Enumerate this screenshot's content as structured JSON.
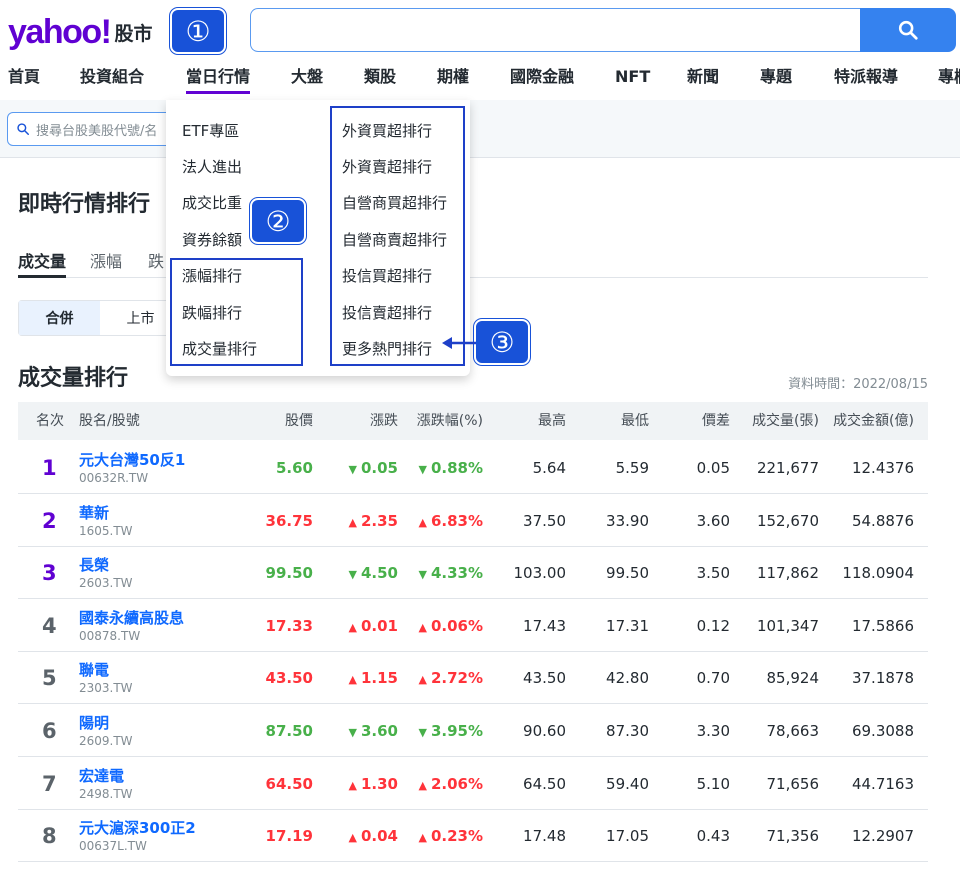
{
  "header": {
    "logo_text": "yahoo!",
    "logo_sub": "股市",
    "badges": [
      "①",
      "②",
      "③"
    ],
    "search_placeholder": "",
    "search_icon": "search-icon"
  },
  "nav": {
    "items": [
      "首頁",
      "投資組合",
      "當日行情",
      "大盤",
      "類股",
      "期權",
      "國際金融",
      "NFT",
      "新聞",
      "專題",
      "特派報導",
      "專欄"
    ],
    "active": "當日行情"
  },
  "quote_search_placeholder": "搜尋台股美股代號/名",
  "dropdown": {
    "left": [
      "ETF專區",
      "法人進出",
      "成交比重",
      "資券餘額",
      "漲幅排行",
      "跌幅排行",
      "成交量排行"
    ],
    "right": [
      "外資買超排行",
      "外資賣超排行",
      "自營商買超排行",
      "自營商賣超排行",
      "投信買超排行",
      "投信賣超排行",
      "更多熱門排行"
    ]
  },
  "page_title": "即時行情排行",
  "tabs": [
    "成交量",
    "漲幅",
    "跌"
  ],
  "segments": [
    "合併",
    "上市"
  ],
  "section_title": "成交量排行",
  "data_time": "資料時間：2022/08/15",
  "table": {
    "headers": [
      "名次",
      "股名/股號",
      "股價",
      "漲跌",
      "漲跌幅(%)",
      "最高",
      "最低",
      "價差",
      "成交量(張)",
      "成交金額(億)"
    ],
    "rows": [
      {
        "rank": "1",
        "name": "元大台灣50反1",
        "code": "00632R.TW",
        "price": "5.60",
        "dir": "down",
        "change": "0.05",
        "pct": "0.88%",
        "high": "5.64",
        "low": "5.59",
        "spread": "0.05",
        "volume": "221,677",
        "amount": "12.4376"
      },
      {
        "rank": "2",
        "name": "華新",
        "code": "1605.TW",
        "price": "36.75",
        "dir": "up",
        "change": "2.35",
        "pct": "6.83%",
        "high": "37.50",
        "low": "33.90",
        "spread": "3.60",
        "volume": "152,670",
        "amount": "54.8876"
      },
      {
        "rank": "3",
        "name": "長榮",
        "code": "2603.TW",
        "price": "99.50",
        "dir": "down",
        "change": "4.50",
        "pct": "4.33%",
        "high": "103.00",
        "low": "99.50",
        "spread": "3.50",
        "volume": "117,862",
        "amount": "118.0904"
      },
      {
        "rank": "4",
        "name": "國泰永續高股息",
        "code": "00878.TW",
        "price": "17.33",
        "dir": "up",
        "change": "0.01",
        "pct": "0.06%",
        "high": "17.43",
        "low": "17.31",
        "spread": "0.12",
        "volume": "101,347",
        "amount": "17.5866"
      },
      {
        "rank": "5",
        "name": "聯電",
        "code": "2303.TW",
        "price": "43.50",
        "dir": "up",
        "change": "1.15",
        "pct": "2.72%",
        "high": "43.50",
        "low": "42.80",
        "spread": "0.70",
        "volume": "85,924",
        "amount": "37.1878"
      },
      {
        "rank": "6",
        "name": "陽明",
        "code": "2609.TW",
        "price": "87.50",
        "dir": "down",
        "change": "3.60",
        "pct": "3.95%",
        "high": "90.60",
        "low": "87.30",
        "spread": "3.30",
        "volume": "78,663",
        "amount": "69.3088"
      },
      {
        "rank": "7",
        "name": "宏達電",
        "code": "2498.TW",
        "price": "64.50",
        "dir": "up",
        "change": "1.30",
        "pct": "2.06%",
        "high": "64.50",
        "low": "59.40",
        "spread": "5.10",
        "volume": "71,656",
        "amount": "44.7163"
      },
      {
        "rank": "8",
        "name": "元大滬深300正2",
        "code": "00637L.TW",
        "price": "17.19",
        "dir": "up",
        "change": "0.04",
        "pct": "0.23%",
        "high": "17.48",
        "low": "17.05",
        "spread": "0.43",
        "volume": "71,356",
        "amount": "12.2907"
      }
    ]
  },
  "colors": {
    "brand": "#6001d2",
    "up": "#ff333a",
    "down": "#48b04a",
    "link": "#0f69ff",
    "highlight": "#1e40c8"
  }
}
